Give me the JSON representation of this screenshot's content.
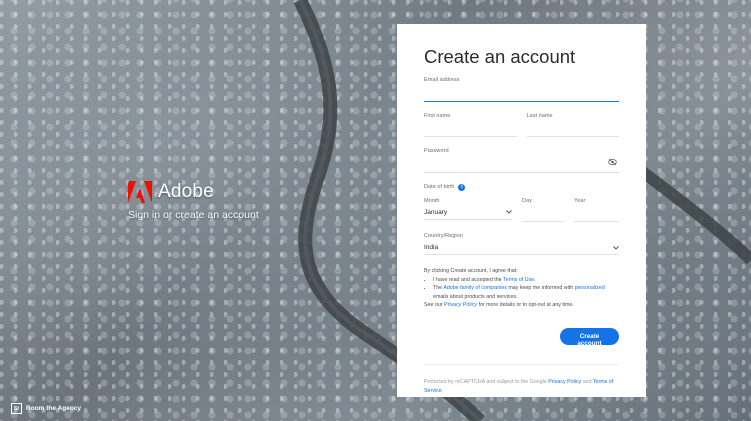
{
  "branding": {
    "name": "Adobe",
    "tagline": "Sign in or create an account",
    "brand_color": "#eb1000"
  },
  "credit": {
    "icon_text": "St",
    "text": "Room the Agency"
  },
  "form": {
    "title": "Create an account",
    "email": {
      "label": "Email address",
      "value": ""
    },
    "first_name": {
      "label": "First name",
      "value": ""
    },
    "last_name": {
      "label": "Last name",
      "value": ""
    },
    "password": {
      "label": "Password",
      "value": "",
      "toggle_icon": "eye-slash-icon"
    },
    "dob": {
      "label": "Date of birth",
      "info_icon": "i",
      "month": {
        "label": "Month",
        "value": "January"
      },
      "day": {
        "label": "Day",
        "value": ""
      },
      "year": {
        "label": "Year",
        "value": ""
      }
    },
    "country": {
      "label": "Country/Region",
      "value": "India"
    },
    "terms": {
      "intro": "By clicking Create account, I agree that:",
      "item1_pre": "I have read and accepted the ",
      "item1_link": "Terms of Use",
      "item1_post": ".",
      "item2_pre": "The ",
      "item2_link1": "Adobe family of companies",
      "item2_mid": " may keep me informed with ",
      "item2_link2": "personalized",
      "item2_post": " emails about products and services.",
      "see_pre": "See our ",
      "see_link": "Privacy Policy",
      "see_post": " for more details or to opt-out at any time."
    },
    "submit_label": "Create account",
    "recaptcha": {
      "pre": "Protected by reCAPTCHA and subject to the Google ",
      "privacy": "Privacy Policy",
      "and": " and ",
      "terms": "Terms of Service",
      "post": "."
    },
    "accent_color": "#1473e6"
  }
}
